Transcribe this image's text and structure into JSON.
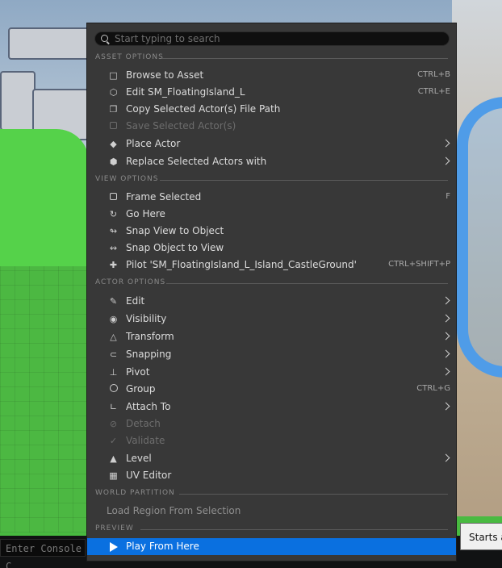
{
  "search": {
    "placeholder": "Start typing to search"
  },
  "sections": {
    "asset_options": "ASSET OPTIONS",
    "view_options": "VIEW OPTIONS",
    "actor_options": "ACTOR OPTIONS",
    "world_partition": "WORLD PARTITION",
    "preview": "PREVIEW"
  },
  "asset_items": [
    {
      "label": "Browse to Asset",
      "shortcut": "CTRL+B",
      "icon": "folder-search-icon"
    },
    {
      "label": "Edit SM_FloatingIsland_L",
      "shortcut": "CTRL+E",
      "icon": "static-mesh-icon"
    },
    {
      "label": "Copy Selected Actor(s) File Path",
      "icon": "copy-icon"
    },
    {
      "label": "Save Selected Actor(s)",
      "icon": "save-icon",
      "disabled": true
    },
    {
      "label": "Place Actor",
      "icon": "place-actor-icon",
      "submenu": true
    },
    {
      "label": "Replace Selected Actors with",
      "icon": "replace-icon",
      "submenu": true
    }
  ],
  "view_items": [
    {
      "label": "Frame Selected",
      "shortcut": "F",
      "icon": "frame-icon"
    },
    {
      "label": "Go Here",
      "icon": "go-here-icon"
    },
    {
      "label": "Snap View to Object",
      "icon": "snap-view-icon"
    },
    {
      "label": "Snap Object to View",
      "icon": "snap-object-icon"
    },
    {
      "label": "Pilot 'SM_FloatingIsland_L_Island_CastleGround'",
      "shortcut": "CTRL+SHIFT+P",
      "icon": "pilot-icon"
    }
  ],
  "actor_items": [
    {
      "label": "Edit",
      "icon": "pencil-icon",
      "submenu": true
    },
    {
      "label": "Visibility",
      "icon": "eye-icon",
      "submenu": true
    },
    {
      "label": "Transform",
      "icon": "transform-icon",
      "submenu": true
    },
    {
      "label": "Snapping",
      "icon": "magnet-icon",
      "submenu": true
    },
    {
      "label": "Pivot",
      "icon": "pivot-icon",
      "submenu": true
    },
    {
      "label": "Group",
      "shortcut": "CTRL+G",
      "icon": "group-icon"
    },
    {
      "label": "Attach To",
      "icon": "paperclip-icon",
      "submenu": true
    },
    {
      "label": "Detach",
      "icon": "detach-icon",
      "disabled": true
    },
    {
      "label": "Validate",
      "icon": "validate-icon",
      "disabled": true
    },
    {
      "label": "Level",
      "icon": "level-icon",
      "submenu": true
    },
    {
      "label": "UV Editor",
      "icon": "uv-grid-icon"
    }
  ],
  "world_partition_items": [
    {
      "label": "Load Region From Selection"
    }
  ],
  "preview_items": [
    {
      "label": "Play From Here",
      "icon": "play-icon"
    }
  ],
  "console": {
    "placeholder": "Enter Console C"
  },
  "tooltip": {
    "text": "Starts a"
  },
  "colors": {
    "menu_bg": "#383838",
    "highlight": "#0a70e0",
    "section_text": "#8a8a8a"
  }
}
